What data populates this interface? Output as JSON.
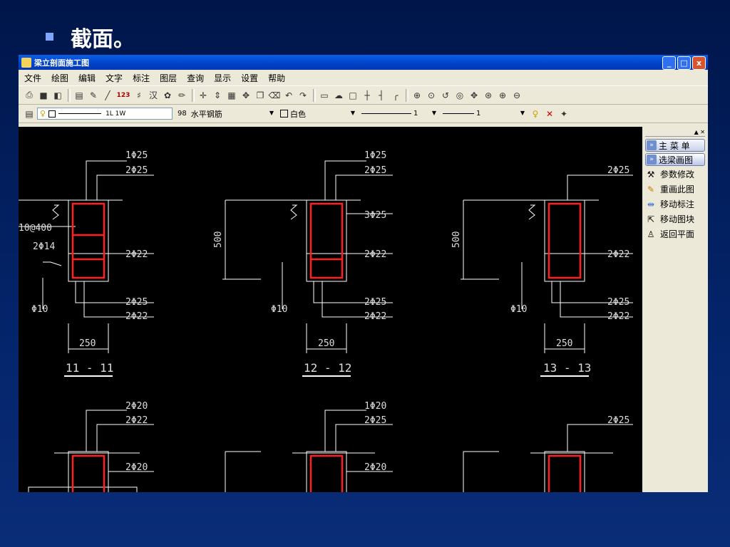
{
  "slide": {
    "title": "截面。"
  },
  "window": {
    "title": "梁立剖面施工图",
    "min": "_",
    "max": "□",
    "close": "x"
  },
  "menu": [
    "文件",
    "绘图",
    "编辑",
    "文字",
    "标注",
    "图层",
    "查询",
    "显示",
    "设置",
    "帮助"
  ],
  "toolbar": {
    "text_tool": "123",
    "linetype": "1L 1W",
    "layer_code": "98",
    "layer_name": "水平钢筋",
    "color": "白色",
    "lineweight_a": "1",
    "lineweight_b": "1"
  },
  "sidepanel": {
    "main_menu": "主 菜 单",
    "select_beam": "选梁画图",
    "items": [
      "参数修改",
      "重画此图",
      "移动标注",
      "移动图块",
      "返回平面"
    ]
  },
  "drawing": {
    "dim_500": "500",
    "dim_250": "250",
    "stirrup": "10@400",
    "waist_bars": "2Φ14",
    "link": "Φ10",
    "sections": [
      {
        "label": "11 - 11",
        "top1": "1Φ25",
        "top2": "2Φ25",
        "mid": "",
        "side": "2Φ22",
        "bot1": "2Φ25",
        "bot2": "2Φ22"
      },
      {
        "label": "12 - 12",
        "top1": "1Φ25",
        "top2": "2Φ25",
        "mid": "3Φ25",
        "side": "2Φ22",
        "bot1": "2Φ25",
        "bot2": "2Φ22"
      },
      {
        "label": "13 - 13",
        "top1": "",
        "top2": "2Φ25",
        "mid": "",
        "side": "2Φ22",
        "bot1": "2Φ25",
        "bot2": "2Φ22"
      }
    ],
    "lower": [
      {
        "top1": "2Φ20",
        "top2": "2Φ22",
        "side": "2Φ20"
      },
      {
        "top1": "1Φ20",
        "top2": "2Φ25",
        "side": "2Φ20"
      },
      {
        "top1": "",
        "top2": "2Φ25",
        "side": ""
      }
    ]
  }
}
